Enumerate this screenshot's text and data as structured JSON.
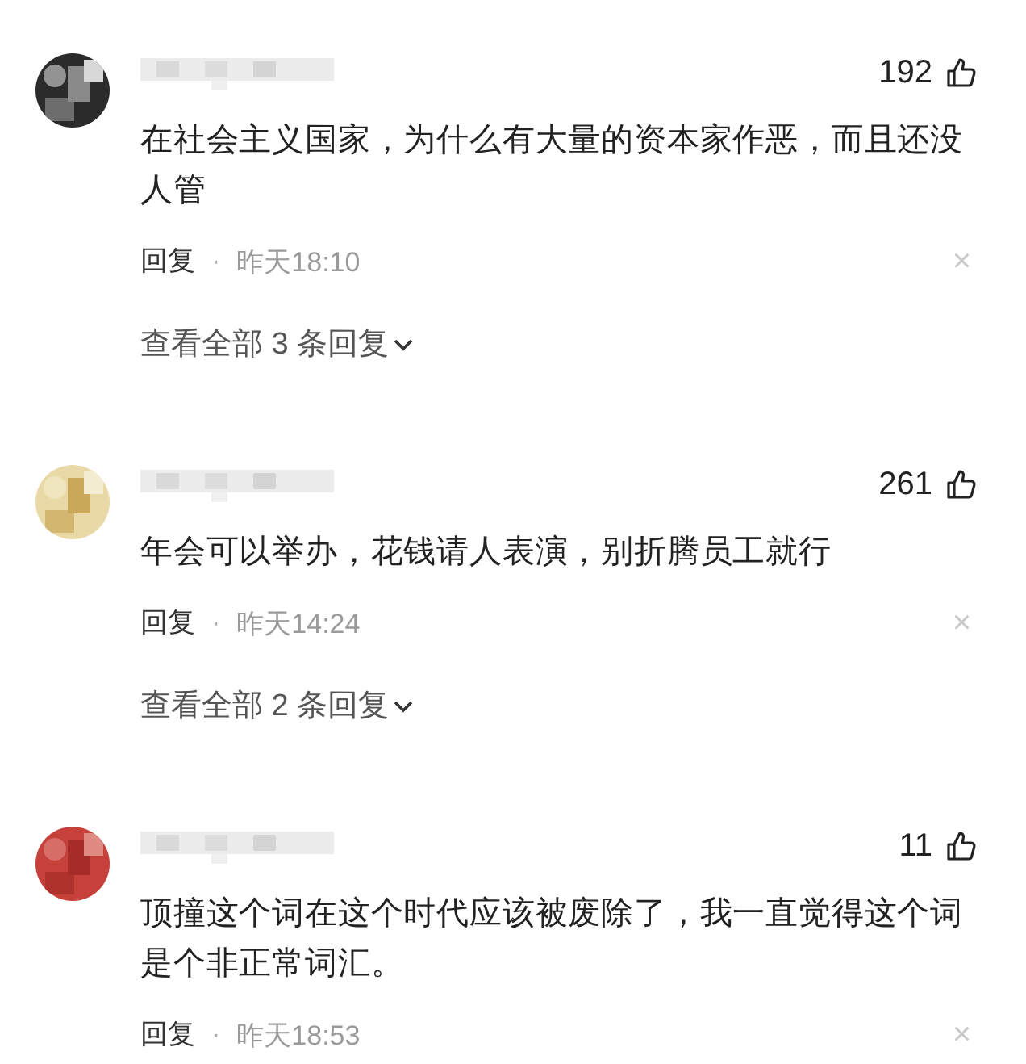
{
  "comments": [
    {
      "likes": "192",
      "text": "在社会主义国家，为什么有大量的资本家作恶，而且还没人管",
      "reply": "回复",
      "separator": "·",
      "time": "昨天18:10",
      "dismiss": "×",
      "more_replies": "查看全部 3 条回复"
    },
    {
      "likes": "261",
      "text": "年会可以举办，花钱请人表演，别折腾员工就行",
      "reply": "回复",
      "separator": "·",
      "time": "昨天14:24",
      "dismiss": "×",
      "more_replies": "查看全部 2 条回复"
    },
    {
      "likes": "11",
      "text": "顶撞这个词在这个时代应该被废除了，我一直觉得这个词是个非正常词汇。",
      "reply": "回复",
      "separator": "·",
      "time": "昨天18:53",
      "dismiss": "×"
    }
  ]
}
